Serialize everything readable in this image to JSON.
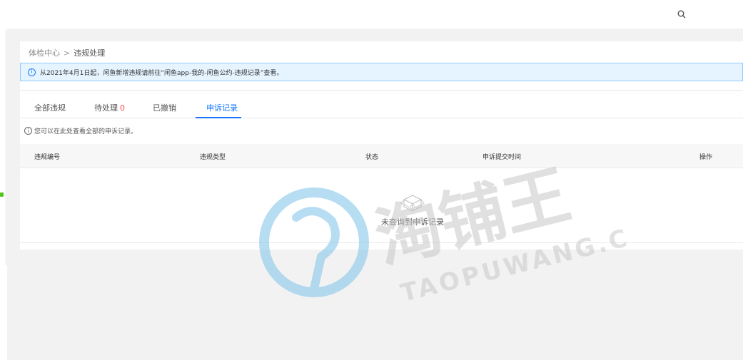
{
  "search": {
    "placeholder": "",
    "icon": "search-icon"
  },
  "breadcrumb": {
    "root": "体检中心",
    "separator": ">",
    "current": "违规处理"
  },
  "notice": {
    "text": "从2021年4月1日起，闲鱼新增违规请前往“闲鱼app-我的-闲鱼公约-违规记录”查看。"
  },
  "tabs": [
    {
      "label": "全部违规"
    },
    {
      "label": "待处理",
      "count": "0"
    },
    {
      "label": "已撤销"
    },
    {
      "label": "申诉记录"
    }
  ],
  "active_tab": "申诉记录",
  "hint": {
    "text": "您可以在此处查看全部的申诉记录。"
  },
  "table": {
    "columns": [
      "违规编号",
      "违规类型",
      "状态",
      "申诉提交时间",
      "操作"
    ],
    "rows": []
  },
  "empty_state": {
    "text": "未查询到申诉记录"
  },
  "watermark": {
    "brand": "淘铺王",
    "domain": "TAOPUWANG.COM"
  },
  "colors": {
    "accent": "#1677ff",
    "count": "#ff4d4f",
    "notice_bg": "#e6f4ff",
    "page_bg": "#f2f2f2"
  }
}
